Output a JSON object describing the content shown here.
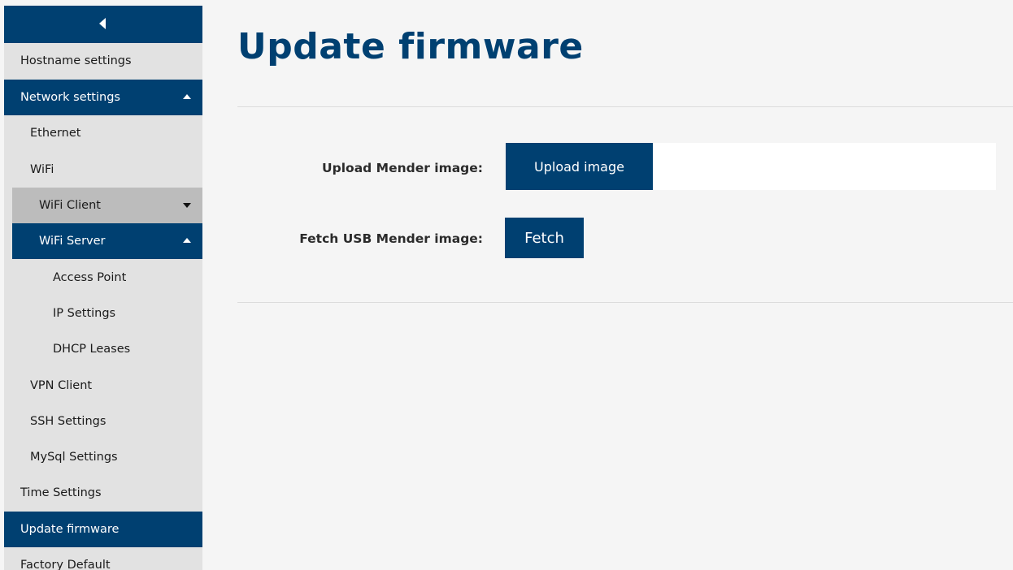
{
  "page": {
    "title": "Update firmware"
  },
  "sidebar": {
    "collapse_icon": "triangle-left-icon",
    "items": [
      {
        "label": "Hostname settings"
      },
      {
        "label": "Network settings",
        "caret": "up"
      },
      {
        "label": "Ethernet"
      },
      {
        "label": "WiFi"
      },
      {
        "label": "WiFi Client",
        "caret": "down"
      },
      {
        "label": "WiFi Server",
        "caret": "up"
      },
      {
        "label": "Access Point"
      },
      {
        "label": "IP Settings"
      },
      {
        "label": "DHCP Leases"
      },
      {
        "label": "VPN Client"
      },
      {
        "label": "SSH Settings"
      },
      {
        "label": "MySql Settings"
      },
      {
        "label": "Time Settings"
      },
      {
        "label": "Update firmware",
        "active": true
      },
      {
        "label": "Factory Default"
      }
    ]
  },
  "form": {
    "upload_label": "Upload Mender image:",
    "upload_button": "Upload image",
    "upload_value": "",
    "fetch_label": "Fetch USB Mender image:",
    "fetch_button": "Fetch"
  },
  "colors": {
    "primary": "#004071",
    "sidebar_bg": "#e2e2e2",
    "sub_grey": "#bcbcbc",
    "page_bg": "#f5f5f5"
  }
}
